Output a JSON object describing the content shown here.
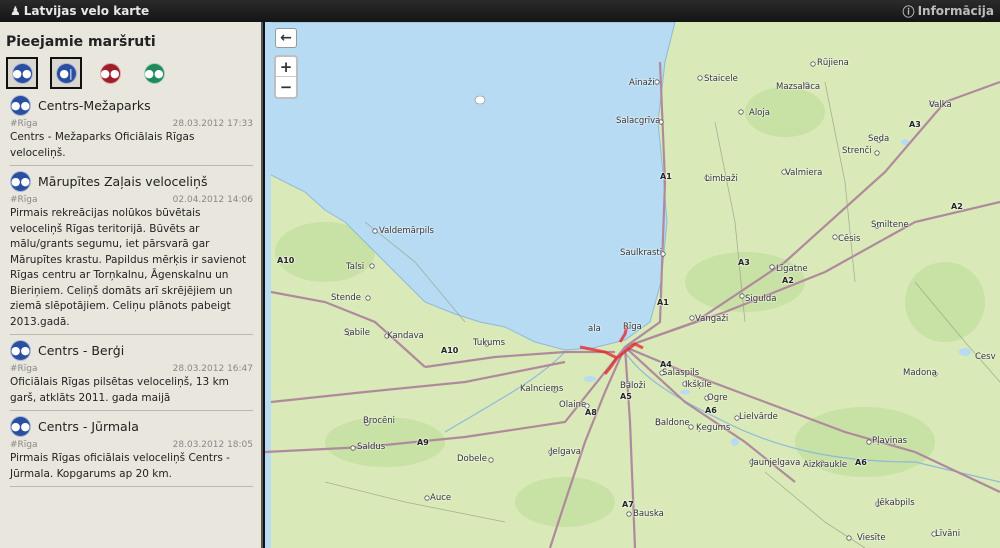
{
  "topbar": {
    "title": "Latvijas velo karte",
    "info": "Informācija"
  },
  "sidebar": {
    "heading": "Pieejamie maršruti",
    "filters": [
      {
        "icon": "bicycle-icon",
        "color": "#2a4fa0",
        "glyph": "🚲"
      },
      {
        "icon": "bike-pedestrian-icon",
        "color": "#2a4fa0",
        "glyph": "🚶"
      },
      {
        "icon": "bicycle-icon",
        "color": "#a01e2a",
        "glyph": "🚲"
      },
      {
        "icon": "bicycle-icon",
        "color": "#1f8a5a",
        "glyph": "🚲"
      }
    ],
    "routes": [
      {
        "title": "Centrs-Mežaparks",
        "tag": "#Rīga",
        "date": "28.03.2012 17:33",
        "desc": "Centrs - Mežaparks Oficiālais Rīgas veloceliņš."
      },
      {
        "title": "Mārupītes Zaļais veloceliņš",
        "tag": "#Rīga",
        "date": "02.04.2012 14:06",
        "desc": "Pirmais rekreācijas nolūkos būvētais veloceliņš Rīgas teritorijā. Būvēts ar mālu/grants segumu, iet pārsvarā gar Mārupītes krastu. Papildus mērķis ir savienot Rīgas centru ar Torņkalnu, Āgenskalnu un Bieriņiem. Celiņš domāts arī skrējējiem un ziemā slēpotājiem. Celiņu plānots pabeigt 2013.gadā."
      },
      {
        "title": "Centrs - Berģi",
        "tag": "#Rīga",
        "date": "28.03.2012 16:47",
        "desc": "Oficiālais Rīgas pilsētas veloceliņš, 13 km garš, atklāts 2011. gada maijā"
      },
      {
        "title": "Centrs - Jūrmala",
        "tag": "#Rīga",
        "date": "28.03.2012 18:05",
        "desc": "Pirmais Rīgas oficiālais veloceliņš Centrs - Jūrmala. Kopgarums ap 20 km."
      }
    ]
  },
  "map": {
    "back": "←",
    "zoom_in": "+",
    "zoom_out": "−",
    "colors": {
      "sea": "#b6dbf3",
      "land": "#d9e9b8",
      "route": "#e8202a",
      "road": "#b08a9c"
    },
    "towns": [
      "Ainaži",
      "Staicele",
      "Rūjiena",
      "Mazsalaca",
      "Valka",
      "Aloja",
      "Salacgrīva",
      "Seda",
      "Strenči",
      "Limbaži",
      "Valmiera",
      "Valdemārpils",
      "Saulkrasti",
      "Cēsis",
      "Smiltene",
      "Talsi",
      "Līgatne",
      "Stende",
      "Sigulda",
      "Sabile",
      "Kandava",
      "Tukums",
      "Vangaži",
      "Rīga",
      "Kalnciems",
      "Salaspils",
      "Baloži",
      "Ikšķile",
      "Olaine",
      "Ogre",
      "Madona",
      "Lielvārde",
      "Ķegums",
      "Baldone",
      "Brocēni",
      "Saldus",
      "Dobele",
      "Jelgava",
      "Pļaviņas",
      "Jaunjelgava",
      "Aizkraukle",
      "Auce",
      "Bauska",
      "Jēkabpils",
      "Viesīte",
      "Līvāni",
      "Cesv",
      "ala"
    ],
    "roads": [
      "A1",
      "A1",
      "A3",
      "A3",
      "A2",
      "A2",
      "A10",
      "A10",
      "A4",
      "A5",
      "A6",
      "A6",
      "A8",
      "A9",
      "A7"
    ]
  }
}
